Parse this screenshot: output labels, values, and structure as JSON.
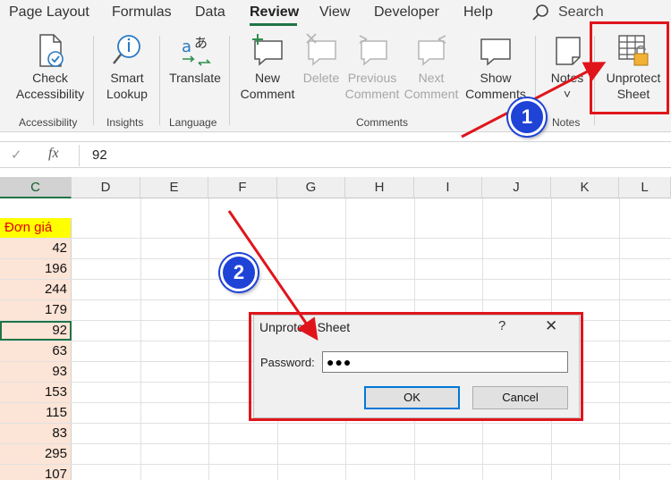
{
  "ribbon_tabs": {
    "page_layout": "Page Layout",
    "formulas": "Formulas",
    "data": "Data",
    "review": "Review",
    "view": "View",
    "developer": "Developer",
    "help": "Help",
    "search": "Search"
  },
  "ribbon": {
    "check_accessibility": [
      "Check",
      "Accessibility"
    ],
    "smart_lookup": [
      "Smart",
      "Lookup"
    ],
    "translate": "Translate",
    "new_comment": [
      "New",
      "Comment"
    ],
    "delete": "Delete",
    "previous_comment": [
      "Previous",
      "Comment"
    ],
    "next_comment": [
      "Next",
      "Comment"
    ],
    "show_comments": [
      "Show",
      "Comments"
    ],
    "notes": "Notes",
    "unprotect_sheet": [
      "Unprotect",
      "Sheet"
    ],
    "groups": {
      "accessibility": "Accessibility",
      "insights": "Insights",
      "language": "Language",
      "comments": "Comments",
      "notes": "Notes"
    }
  },
  "formula_bar": {
    "fx": "fx",
    "value": "92"
  },
  "columns": [
    "C",
    "D",
    "E",
    "F",
    "G",
    "H",
    "I",
    "J",
    "K",
    "L"
  ],
  "column_c": {
    "header": "Đơn giá",
    "values": [
      "42",
      "196",
      "244",
      "179",
      "92",
      "63",
      "93",
      "153",
      "115",
      "83",
      "295",
      "107"
    ]
  },
  "dialog": {
    "title": "Unprotect Sheet",
    "help": "?",
    "close": "✕",
    "password_label": "Password:",
    "password_value": "●●●",
    "ok": "OK",
    "cancel": "Cancel"
  },
  "annotations": {
    "step1": "1",
    "step2": "2"
  },
  "colors": {
    "accent_green": "#217346",
    "highlight_red": "#e0151b",
    "badge_blue": "#1f43d6",
    "header_yellow": "#ffff00",
    "cell_peach": "#fce4d6"
  }
}
